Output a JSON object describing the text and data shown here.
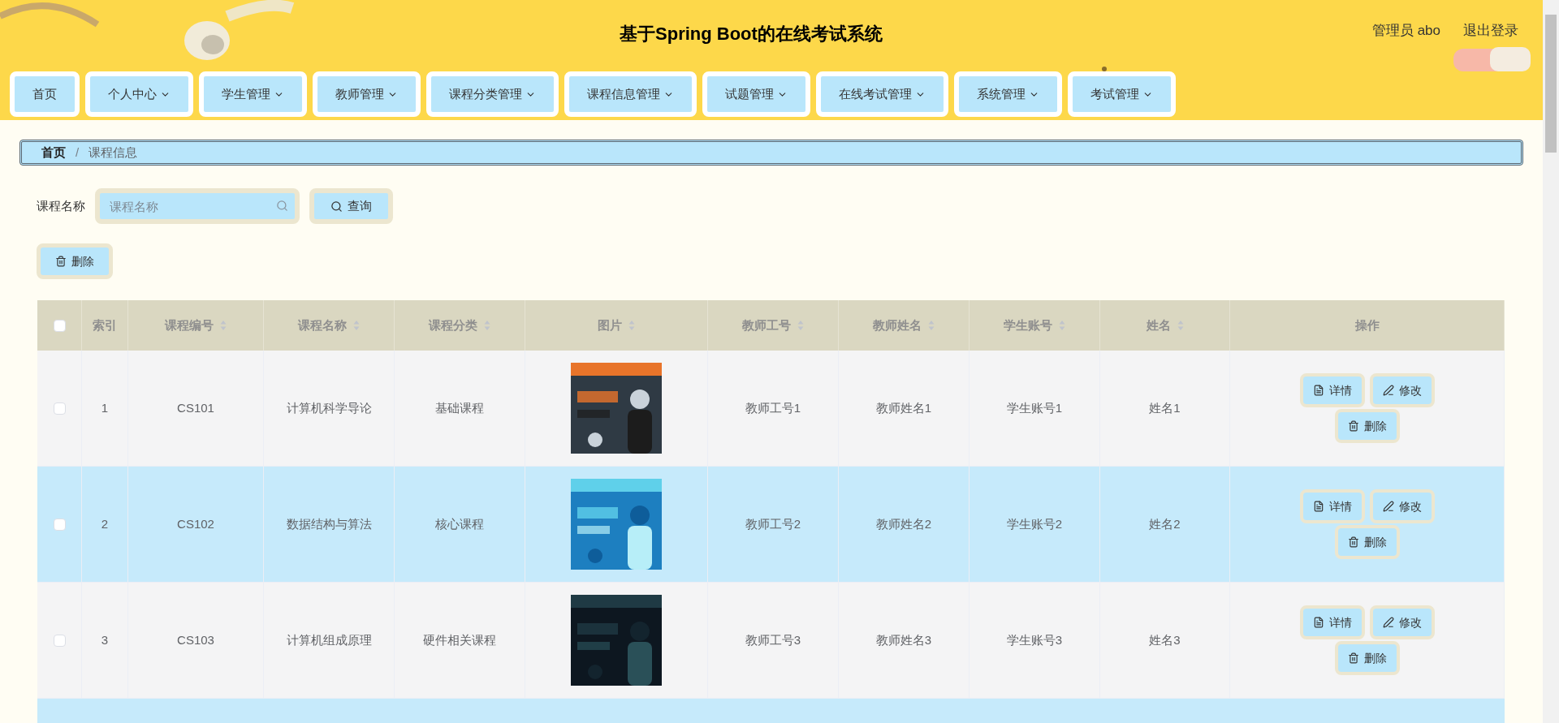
{
  "header": {
    "title": "基于Spring Boot的在线考试系统",
    "user": "管理员 abo",
    "logout": "退出登录"
  },
  "nav": [
    {
      "label": "首页",
      "has_menu": false
    },
    {
      "label": "个人中心",
      "has_menu": true
    },
    {
      "label": "学生管理",
      "has_menu": true
    },
    {
      "label": "教师管理",
      "has_menu": true
    },
    {
      "label": "课程分类管理",
      "has_menu": true
    },
    {
      "label": "课程信息管理",
      "has_menu": true
    },
    {
      "label": "试题管理",
      "has_menu": true
    },
    {
      "label": "在线考试管理",
      "has_menu": true
    },
    {
      "label": "系统管理",
      "has_menu": true
    },
    {
      "label": "考试管理",
      "has_menu": true
    }
  ],
  "breadcrumb": {
    "items": [
      "首页",
      "课程信息"
    ],
    "separator": "/"
  },
  "search": {
    "label": "课程名称",
    "placeholder": "课程名称",
    "button": "查询"
  },
  "delete_button": "删除",
  "table": {
    "select_all_checked": false,
    "columns": [
      {
        "label": "索引",
        "sortable": false
      },
      {
        "label": "课程编号",
        "sortable": true
      },
      {
        "label": "课程名称",
        "sortable": true
      },
      {
        "label": "课程分类",
        "sortable": true
      },
      {
        "label": "图片",
        "sortable": true
      },
      {
        "label": "教师工号",
        "sortable": true
      },
      {
        "label": "教师姓名",
        "sortable": true
      },
      {
        "label": "学生账号",
        "sortable": true
      },
      {
        "label": "姓名",
        "sortable": true
      },
      {
        "label": "操作",
        "sortable": false
      }
    ],
    "rows": [
      {
        "checked": false,
        "cells": [
          "1",
          "CS101",
          "计算机科学导论",
          "基础课程",
          {
            "kind": "picture"
          },
          "教师工号1",
          "教师姓名1",
          "学生账号1",
          "姓名1"
        ],
        "actions": [
          "详情",
          "修改",
          "删除"
        ]
      },
      {
        "checked": false,
        "cells": [
          "2",
          "CS102",
          "数据结构与算法",
          "核心课程",
          {
            "kind": "picture"
          },
          "教师工号2",
          "教师姓名2",
          "学生账号2",
          "姓名2"
        ],
        "actions": [
          "详情",
          "修改",
          "删除"
        ]
      },
      {
        "checked": false,
        "cells": [
          "3",
          "CS103",
          "计算机组成原理",
          "硬件相关课程",
          {
            "kind": "picture"
          },
          "教师工号3",
          "教师姓名3",
          "学生账号3",
          "姓名3"
        ],
        "actions": [
          "详情",
          "修改",
          "删除"
        ]
      }
    ]
  }
}
